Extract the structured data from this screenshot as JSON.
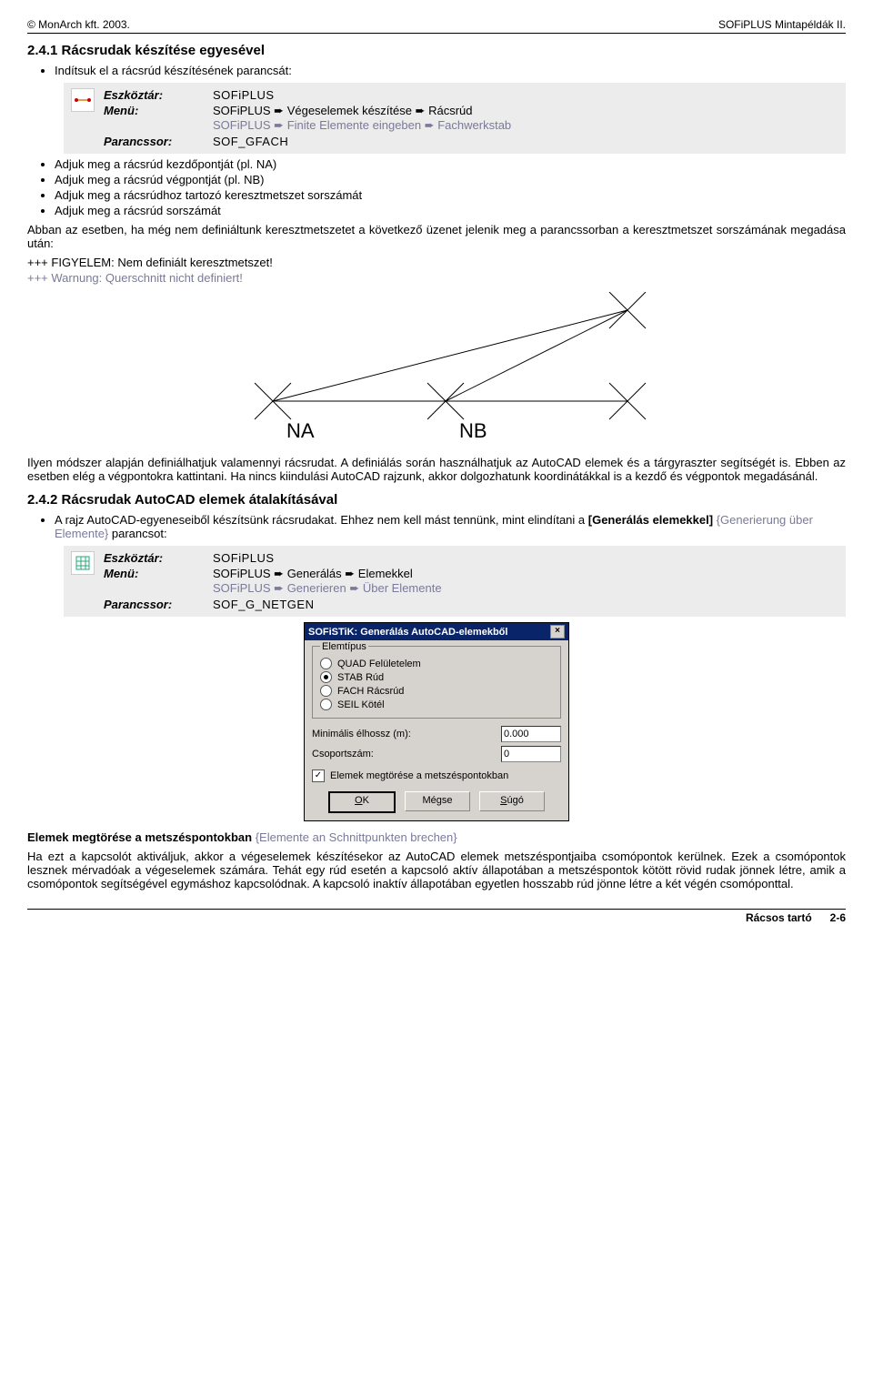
{
  "header": {
    "left": "© MonArch kft. 2003.",
    "right": "SOFiPLUS Mintapéldák II."
  },
  "s241": {
    "title": "2.4.1 Rácsrudak készítése egyesével",
    "intro_bullet": "Indítsuk el a rácsrúd készítésének parancsát:",
    "cmd": {
      "eszkoztar_label": "Eszköztár:",
      "eszkoztar_value": "SOFiPLUS",
      "menu_label": "Menü:",
      "menu_value_1a": "SOFiPLUS ➨ Végeselemek készítése ➨ Rácsrúd",
      "menu_value_1b": "SOFiPLUS ➨ Finite Elemente eingeben ➨ Fachwerkstab",
      "parancssor_label": "Parancssor:",
      "parancssor_value": "SOF_GFACH"
    },
    "bullets_after": [
      "Adjuk meg a rácsrúd kezdőpontját (pl. NA)",
      "Adjuk meg a rácsrúd végpontját (pl. NB)",
      "Adjuk meg a rácsrúdhoz tartozó keresztmetszet sorszámát",
      "Adjuk meg a rácsrúd sorszámát"
    ],
    "para1": "Abban az esetben, ha még nem definiáltunk keresztmetszetet a következő üzenet jelenik meg a parancssorban a keresztmetszet sorszámának megadása után:",
    "warn1": "+++ FIGYELEM: Nem definiált keresztmetszet!",
    "warn2": "+++ Warnung: Querschnitt nicht definiert!",
    "diagram": {
      "na_label": "NA",
      "nb_label": "NB"
    },
    "para2": "Ilyen módszer alapján definiálhatjuk valamennyi rácsrudat. A definiálás során használhatjuk az AutoCAD elemek és a tárgyraszter segítségét is. Ebben az esetben elég a végpontokra kattintani. Ha nincs kiindulási AutoCAD rajzunk, akkor dolgozhatunk koordinátákkal is a kezdő és végpontok megadásánál."
  },
  "s242": {
    "title": "2.4.2 Rácsrudak AutoCAD elemek átalakításával",
    "intro_bullet_a": "A rajz AutoCAD-egyeneseiből készítsünk rácsrudakat. Ehhez nem kell mást tennünk, mint elindítani a ",
    "intro_bullet_b": "[Generálás elemekkel]",
    "intro_bullet_c": " {Generierung über Elemente}",
    "intro_bullet_d": " parancsot:",
    "cmd": {
      "eszkoztar_label": "Eszköztár:",
      "eszkoztar_value": "SOFiPLUS",
      "menu_label": "Menü:",
      "menu_value_1a": "SOFiPLUS ➨ Generálás ➨ Elemekkel",
      "menu_value_1b": "SOFiPLUS ➨ Generieren ➨ Über Elemente",
      "parancssor_label": "Parancssor:",
      "parancssor_value": "SOF_G_NETGEN"
    },
    "dialog": {
      "title": "SOFiSTiK: Generálás AutoCAD-elemekből",
      "group_label": "Elemtípus",
      "radios": [
        {
          "label": "QUAD Felületelem",
          "selected": false
        },
        {
          "label": "STAB Rúd",
          "selected": true
        },
        {
          "label": "FACH Rácsrúd",
          "selected": false
        },
        {
          "label": "SEIL Kötél",
          "selected": false
        }
      ],
      "min_edge_label": "Minimális élhossz (m):",
      "min_edge_value": "0.000",
      "group_num_label": "Csoportszám:",
      "group_num_value": "0",
      "checkbox_label": "Elemek megtörése a metszéspontokban",
      "checkbox_checked": true,
      "btn_ok": "OK",
      "btn_cancel": "Mégse",
      "btn_help": "Súgó"
    },
    "subhead_a": "Elemek megtörése a metszéspontokban",
    "subhead_b": " {Elemente an Schnittpunkten brechen}",
    "para": "Ha ezt a kapcsolót aktiváljuk, akkor a végeselemek készítésekor az AutoCAD elemek metszéspontjaiba csomópontok kerülnek. Ezek a csomópontok lesznek mérvadóak a végeselemek számára. Tehát egy rúd esetén a kapcsoló aktív állapotában a metszéspontok kötött rövid rudak jönnek létre, amik a csomópontok segítségével egymáshoz kapcsolódnak. A kapcsoló inaktív állapotában egyetlen hosszabb rúd jönne létre a két végén csomóponttal."
  },
  "footer": {
    "section": "Rácsos tartó",
    "page": "2-6"
  }
}
